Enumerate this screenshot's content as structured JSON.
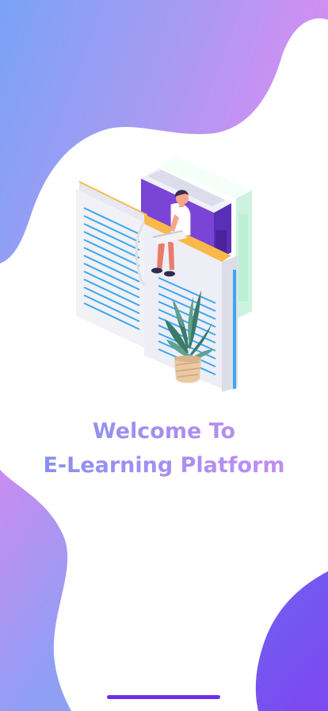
{
  "welcome": {
    "line1": "Welcome To",
    "line2": "E-Learning Platform"
  },
  "colors": {
    "gradient_start": "#7fa6f5",
    "gradient_end": "#d58af3",
    "title_start": "#7f8ff2",
    "title_end": "#c98ef0",
    "accent_purple": "#6b2fe8",
    "book_purple": "#7a45d6",
    "page_line_blue": "#3aa8f0"
  },
  "icons": {
    "hero": "person-reading-on-books-illustration",
    "plant": "potted-plant-illustration"
  }
}
